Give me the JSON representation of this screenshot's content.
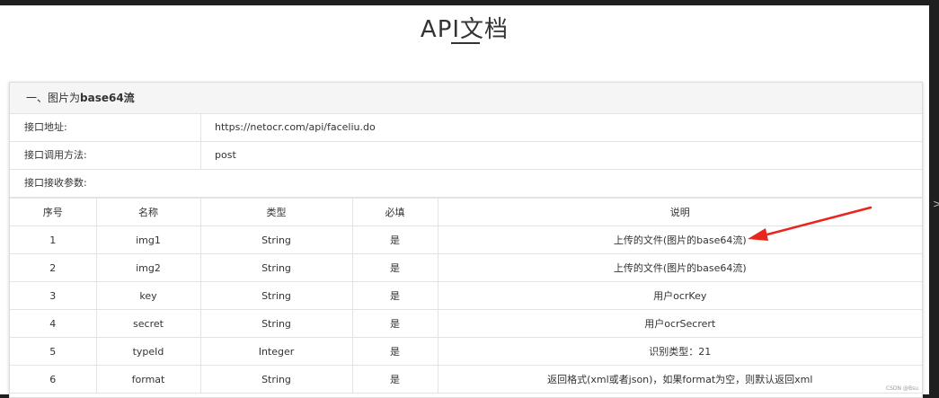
{
  "page": {
    "title": "API文档",
    "watermark": "CSDN @Bsu",
    "edge_mark": ">"
  },
  "section": {
    "prefix": "一、图片为",
    "bold": "base64流"
  },
  "info": [
    {
      "label": "接口地址:",
      "value": "https://netocr.com/api/faceliu.do"
    },
    {
      "label": "接口调用方法:",
      "value": "post"
    },
    {
      "label": "接口接收参数:",
      "value": ""
    }
  ],
  "table": {
    "headers": [
      "序号",
      "名称",
      "类型",
      "必填",
      "说明"
    ],
    "rows": [
      [
        "1",
        "img1",
        "String",
        "是",
        "上传的文件(图片的base64流)"
      ],
      [
        "2",
        "img2",
        "String",
        "是",
        "上传的文件(图片的base64流)"
      ],
      [
        "3",
        "key",
        "String",
        "是",
        "用户ocrKey"
      ],
      [
        "4",
        "secret",
        "String",
        "是",
        "用户ocrSecrert"
      ],
      [
        "5",
        "typeId",
        "Integer",
        "是",
        "识别类型：21"
      ],
      [
        "6",
        "format",
        "String",
        "是",
        "返回格式(xml或者json)，如果format为空，则默认返回xml"
      ]
    ]
  },
  "colors": {
    "annotation_arrow": "#e8261e"
  }
}
